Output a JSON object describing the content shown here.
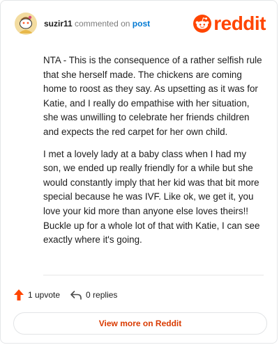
{
  "header": {
    "username": "suzir11",
    "action_text": "commented on",
    "post_link": "post",
    "logo_text": "reddit"
  },
  "comment": {
    "paragraphs": [
      "NTA - This is the consequence of a rather selfish rule that she herself made. The chickens are coming home to roost as they say. As upsetting as it was for Katie, and I really do empathise with her situation, she was unwilling to celebrate her friends children and expects the red carpet for her own child.",
      "I met a lovely lady at a baby class when I had my son, we ended up really friendly for a while but she would constantly imply that her kid was that bit more special because he was IVF. Like ok, we get it, you love your kid more than anyone else loves theirs!! Buckle up for a whole lot of that with Katie, I can see exactly where it's going."
    ]
  },
  "footer": {
    "upvote_label": "1 upvote",
    "replies_label": "0 replies",
    "upvote_icon": "upvote-arrow-icon",
    "replies_icon": "reply-arrow-icon"
  },
  "cta": {
    "view_more_label": "View more on Reddit"
  },
  "colors": {
    "brand": "#ff4500",
    "link": "#0079d3",
    "cta_text": "#d93a00"
  }
}
